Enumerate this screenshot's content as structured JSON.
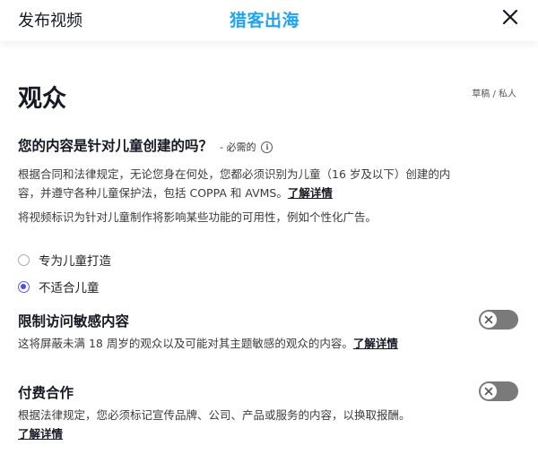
{
  "header": {
    "title": "发布视频",
    "brand": "猎客出海"
  },
  "section": {
    "title": "观众",
    "status": "草稿 / 私人"
  },
  "kids_question": {
    "title": "您的内容是针对儿童创建的吗？",
    "required": "- 必需的",
    "desc_line1": "根据合同和法律规定，无论您身在何处，您都必须识别为儿童（16 岁及以下）创建的内",
    "desc_line2": "容，并遵守各种儿童保护法，包括 COPPA 和 AVMS。",
    "learn_more": "了解详情",
    "note": "将视频标识为针对儿童制作将影响某些功能的可用性，例如个性化广告。",
    "options": [
      {
        "label": "专为儿童打造",
        "checked": false
      },
      {
        "label": "不适合儿童",
        "checked": true
      }
    ]
  },
  "restrict": {
    "title": "限制访问敏感内容",
    "desc": "这将屏蔽未满 18 周岁的观众以及可能对其主题敏感的观众的内容。",
    "learn_more": "了解详情",
    "enabled": false
  },
  "paid": {
    "title": "付费合作",
    "desc": "根据法律规定，您必须标记宣传品牌、公司、产品或服务的内容，以换取报酬。",
    "learn_more": "了解详情",
    "enabled": false
  },
  "colors": {
    "accent": "#4b50e6",
    "brand": "#21a4ee",
    "toggle_off": "#7a7a7a"
  },
  "icons": {
    "close": "close-icon",
    "info": "info-icon",
    "toggle_off": "x-icon"
  }
}
